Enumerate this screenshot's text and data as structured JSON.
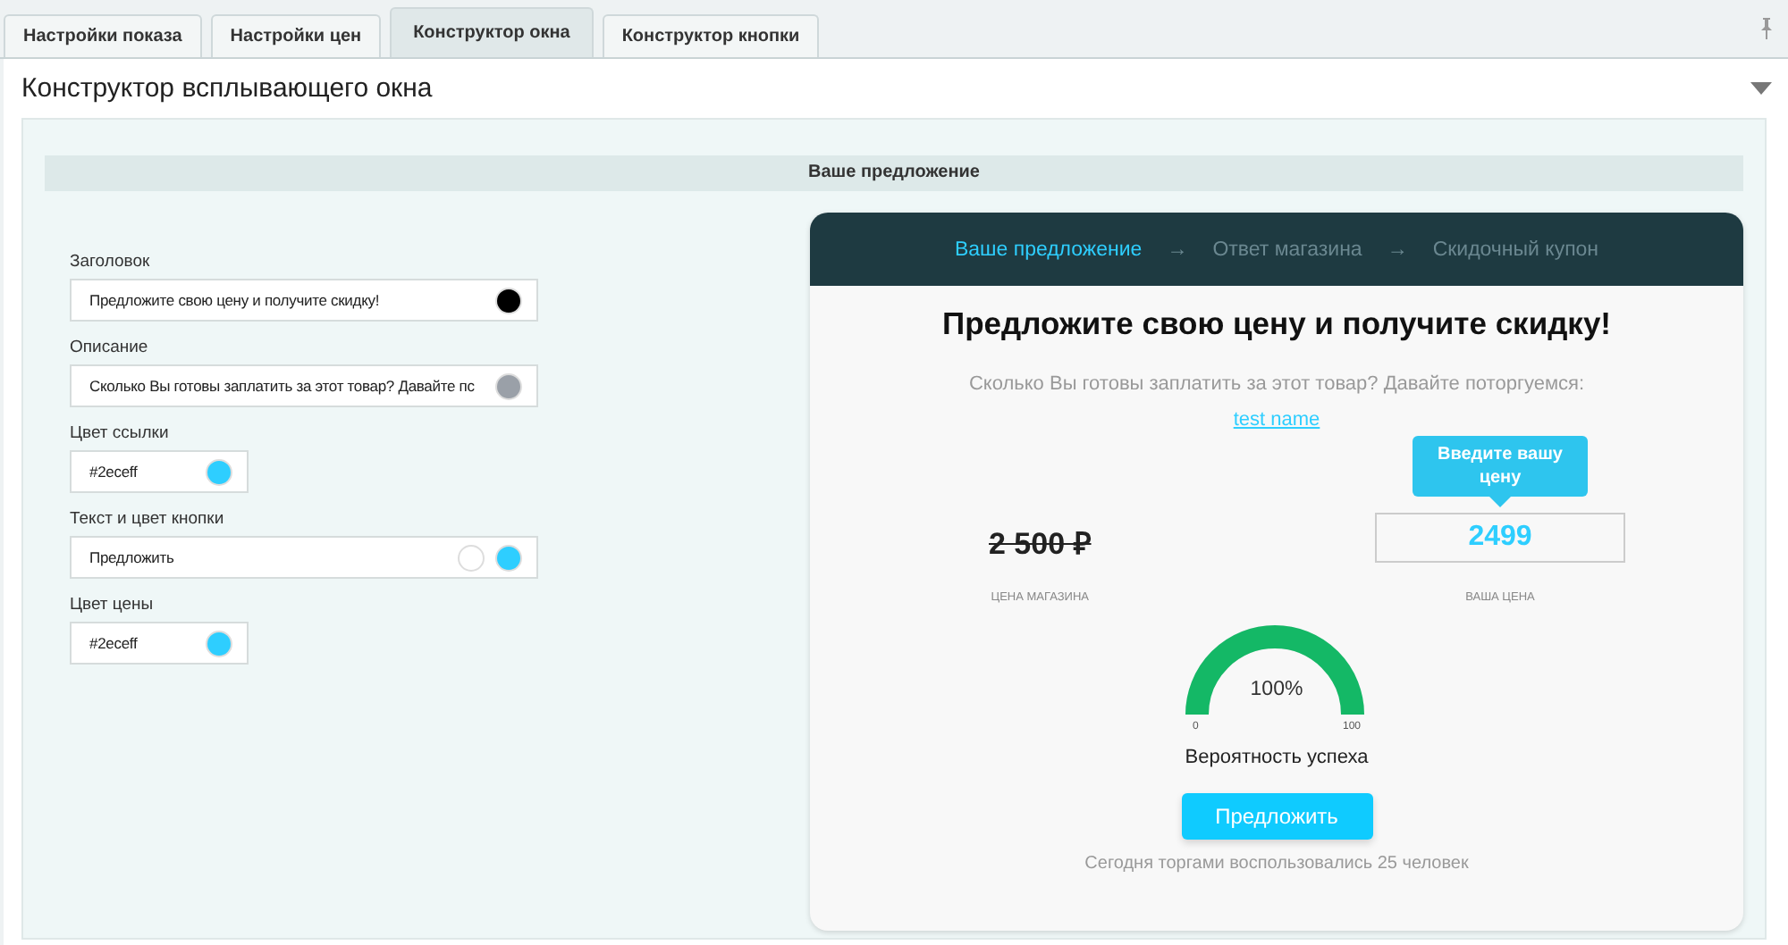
{
  "tabs": [
    {
      "label": "Настройки показа",
      "selected": false
    },
    {
      "label": "Настройки цен",
      "selected": false
    },
    {
      "label": "Конструктор окна",
      "selected": true
    },
    {
      "label": "Конструктор кнопки",
      "selected": false
    }
  ],
  "panel": {
    "title": "Конструктор всплывающего окна",
    "expanded": true
  },
  "section": {
    "title": "Ваше предложение"
  },
  "form": {
    "fields": [
      {
        "label": "Заголовок",
        "value": "Предложите свою цену и получите скидку!",
        "kind": "wide",
        "swatches": [
          {
            "color": "#000000"
          }
        ]
      },
      {
        "label": "Описание",
        "value": "Сколько Вы готовы заплатить за этот товар? Давайте пс",
        "kind": "wide",
        "swatches": [
          {
            "color": "#9aa0a8"
          }
        ]
      },
      {
        "label": "Цвет ссылки",
        "value": "#2eceff",
        "kind": "narrow",
        "swatches": [
          {
            "color": "#2eceff"
          }
        ]
      },
      {
        "label": "Текст и цвет кнопки",
        "value": "Предложить",
        "kind": "wide",
        "swatches": [
          {
            "color": "#ffffff"
          },
          {
            "color": "#2eceff"
          }
        ]
      },
      {
        "label": "Цвет цены",
        "value": "#2eceff",
        "kind": "narrow",
        "swatches": [
          {
            "color": "#2eceff"
          }
        ]
      }
    ]
  },
  "preview": {
    "steps": [
      {
        "label": "Ваше предложение",
        "selected": true
      },
      {
        "label": "Ответ магазина",
        "selected": false
      },
      {
        "label": "Скидочный купон",
        "selected": false
      }
    ],
    "step_arrow": "→",
    "title": "Предложите свою цену и получите скидку!",
    "description": "Сколько Вы готовы заплатить за этот товар? Давайте поторгуемся:",
    "link": "test name",
    "old_price": "2 500 ₽",
    "old_price_label": "ЦЕНА МАГАЗИНА",
    "tooltip": "Введите вашу цену",
    "price_value": "2499",
    "price_label": "ВАША ЦЕНА",
    "gauge": {
      "level": 1,
      "reading": "100%",
      "min": "0",
      "max": "100",
      "label": "Вероятность успеха"
    },
    "button": "Предложить",
    "footer": "Сегодня торгами воспользовались 25 человек"
  }
}
